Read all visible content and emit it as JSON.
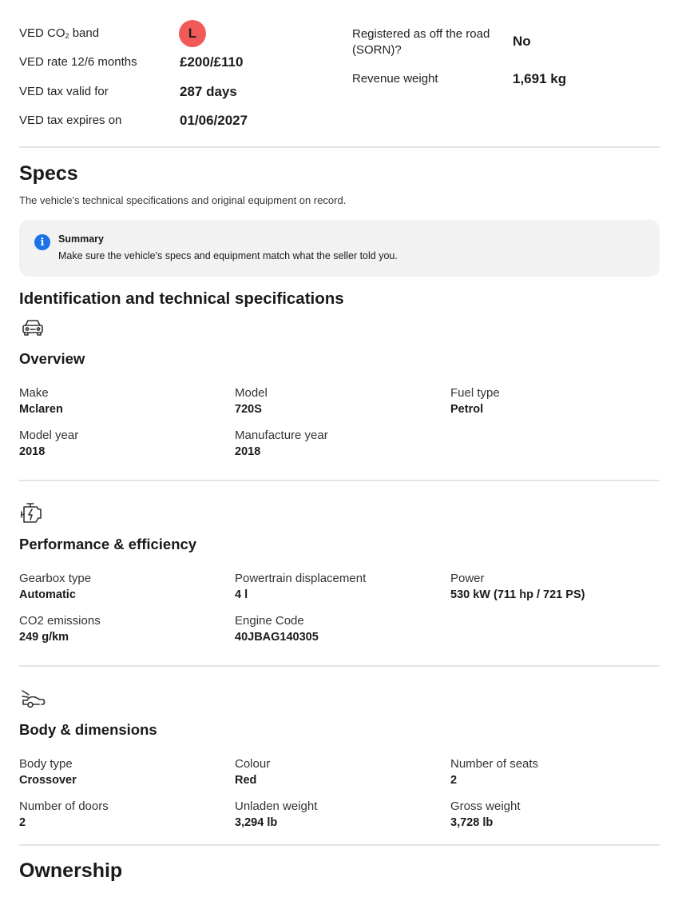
{
  "ved": {
    "co2_band_label": "VED CO",
    "co2_band_sub": "2",
    "co2_band_label_suffix": " band",
    "co2_band_value": "L",
    "rate_label": "VED rate 12/6 months",
    "rate_value": "£200/£110",
    "valid_label": "VED tax valid for",
    "valid_value": "287 days",
    "expires_label": "VED tax expires on",
    "expires_value": "01/06/2027",
    "sorn_label_line1": "Registered as off the road",
    "sorn_label_line2": "(SORN)?",
    "sorn_value": "No",
    "revenue_weight_label": "Revenue weight",
    "revenue_weight_value": "1,691 kg",
    "band_color": "#f25a5a"
  },
  "specs": {
    "title": "Specs",
    "subtitle": "The vehicle's technical specifications and original equipment on record.",
    "summary": {
      "icon": "info-icon",
      "title": "Summary",
      "text": "Make sure the vehicle's specs and equipment match what the seller told you."
    },
    "identification_title": "Identification and technical specifications"
  },
  "overview": {
    "icon": "car-front-icon",
    "title": "Overview",
    "items": [
      {
        "label": "Make",
        "value": "Mclaren"
      },
      {
        "label": "Model",
        "value": "720S"
      },
      {
        "label": "Fuel type",
        "value": "Petrol"
      },
      {
        "label": "Model year",
        "value": "2018"
      },
      {
        "label": "Manufacture year",
        "value": "2018"
      }
    ]
  },
  "performance": {
    "icon": "engine-icon",
    "title": "Performance & efficiency",
    "items": [
      {
        "label": "Gearbox type",
        "value": "Automatic"
      },
      {
        "label": "Powertrain displacement",
        "value": "4 l"
      },
      {
        "label": "Power",
        "value": "530 kW (711 hp / 721 PS)"
      },
      {
        "label": "CO2 emissions",
        "value": "249 g/km"
      },
      {
        "label": "Engine Code",
        "value": "40JBAG140305"
      }
    ]
  },
  "body": {
    "icon": "car-side-icon",
    "title": "Body & dimensions",
    "items": [
      {
        "label": "Body type",
        "value": "Crossover"
      },
      {
        "label": "Colour",
        "value": "Red"
      },
      {
        "label": "Number of seats",
        "value": "2"
      },
      {
        "label": "Number of doors",
        "value": "2"
      },
      {
        "label": "Unladen weight",
        "value": "3,294 lb"
      },
      {
        "label": "Gross weight",
        "value": "3,728 lb"
      }
    ]
  },
  "ownership": {
    "title": "Ownership"
  },
  "colors": {
    "accent_blue": "#1a73e8",
    "divider": "#e4e4e4",
    "summary_bg": "#f2f2f2"
  }
}
